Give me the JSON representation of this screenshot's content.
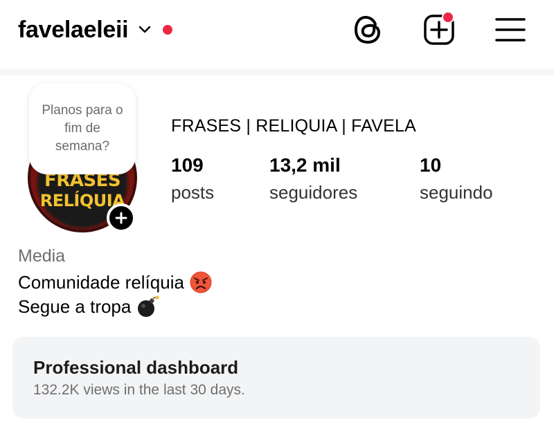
{
  "header": {
    "username": "favelaeleii",
    "icons": [
      "chevron-down-icon",
      "threads-icon",
      "create-post-icon",
      "menu-icon"
    ]
  },
  "profile": {
    "note": "Planos para o fim de semana?",
    "avatar_text_line1": "FRASES",
    "avatar_text_line2": "RELÍQUIA",
    "display_name": "FRASES | RELIQUIA | FAVELA",
    "stats": [
      {
        "value": "109",
        "label": "posts"
      },
      {
        "value": "13,2 mil",
        "label": "seguidores"
      },
      {
        "value": "10",
        "label": "seguindo"
      }
    ],
    "category": "Media",
    "bio_line1": "Comunidade relíquia",
    "bio_line1_emoji": "angry-face",
    "bio_line2": "Segue a tropa",
    "bio_line2_emoji": "bomb"
  },
  "dashboard": {
    "title": "Professional dashboard",
    "subtitle": "132.2K views in the last 30 days."
  },
  "colors": {
    "notification_red": "#ed2846",
    "accent_black": "#000000",
    "avatar_text": "#f2c230",
    "card_bg": "#f3f4f6"
  }
}
